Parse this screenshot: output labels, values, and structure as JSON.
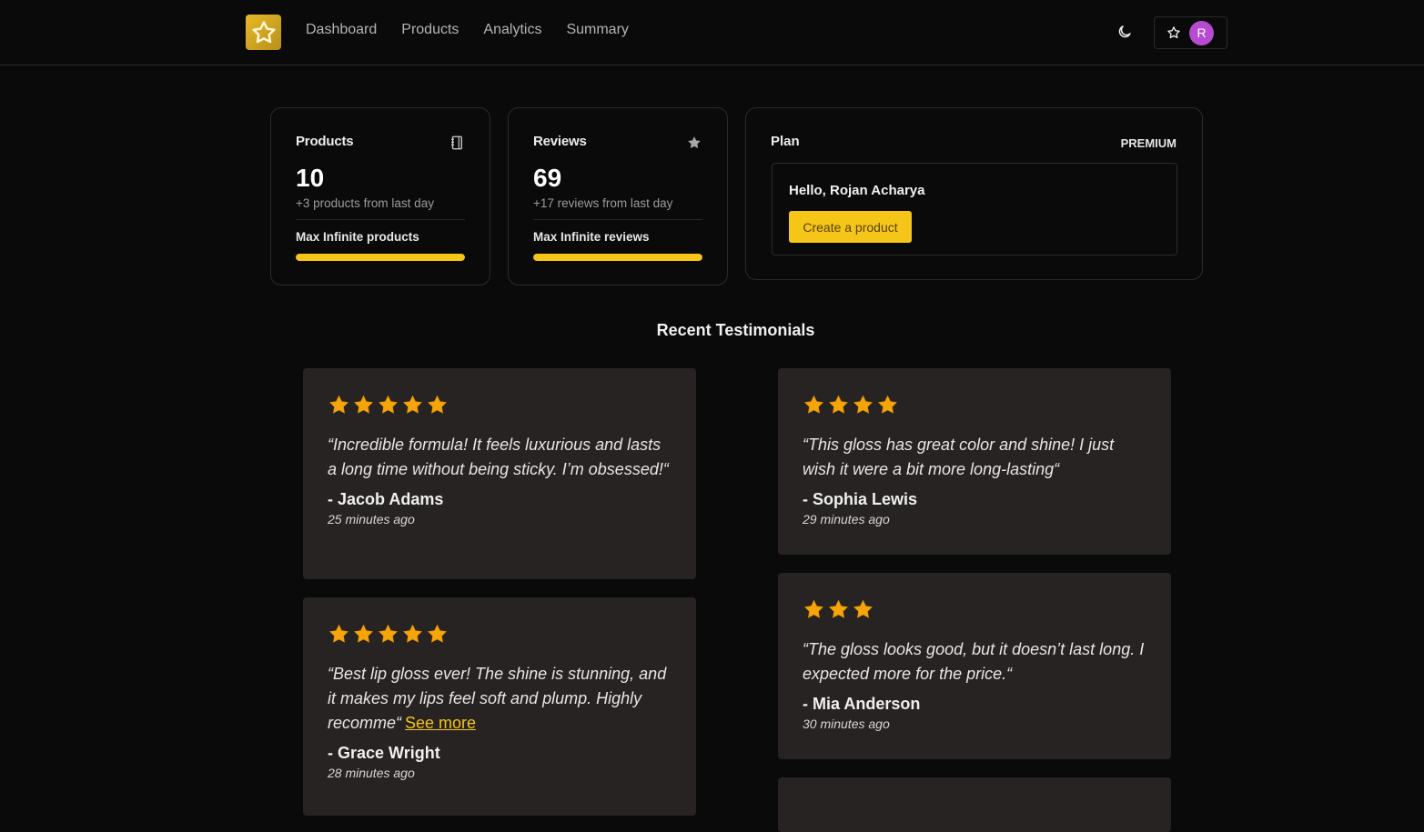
{
  "nav": {
    "logo": "star-logo",
    "links": [
      "Dashboard",
      "Products",
      "Analytics",
      "Summary"
    ],
    "theme_icon": "moon-icon",
    "favorite_icon": "star-outline-icon",
    "avatar_initial": "R"
  },
  "stats": {
    "products": {
      "title": "Products",
      "icon": "notebook-icon",
      "value": "10",
      "change": "+3 products from last day",
      "max_label": "Max Infinite products",
      "progress_percent": 100
    },
    "reviews": {
      "title": "Reviews",
      "icon": "star-icon",
      "value": "69",
      "change": "+17 reviews from last day",
      "max_label": "Max Infinite reviews",
      "progress_percent": 100
    }
  },
  "plan": {
    "title": "Plan",
    "badge": "PREMIUM",
    "greeting": "Hello, Rojan Acharya",
    "cta_label": "Create a product"
  },
  "testimonials": {
    "title": "Recent Testimonials",
    "items": [
      {
        "rating": 5,
        "quote": "“Incredible formula! It feels luxurious and lasts a long time without being sticky. I’m obsessed!“",
        "author": "- Jacob Adams",
        "time": "25 minutes ago"
      },
      {
        "rating": 4,
        "quote": "“This gloss has great color and shine! I just wish it were a bit more long-lasting“",
        "author": "- Sophia Lewis",
        "time": "29 minutes ago"
      },
      {
        "rating": 5,
        "quote": "“Best lip gloss ever! The shine is stunning, and it makes my lips feel soft and plump. Highly recomme“",
        "see_more": "See more",
        "author": "- Grace Wright",
        "time": "28 minutes ago"
      },
      {
        "rating": 3,
        "quote": "“The gloss looks good, but it doesn’t last long. I expected more for the price.“",
        "author": "- Mia Anderson",
        "time": "30 minutes ago"
      }
    ]
  },
  "colors": {
    "accent": "#f5c518",
    "star": "#f5a50a",
    "card_bg": "#272322",
    "background": "#0b0a0a",
    "avatar": "#b54ccf"
  }
}
